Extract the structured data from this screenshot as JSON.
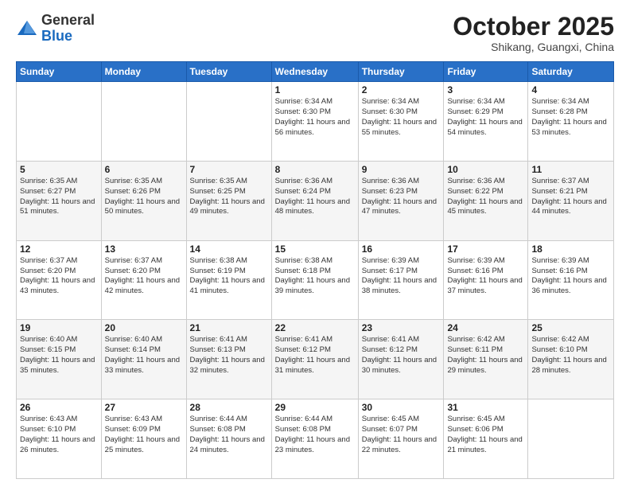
{
  "header": {
    "logo_general": "General",
    "logo_blue": "Blue",
    "month_title": "October 2025",
    "location": "Shikang, Guangxi, China"
  },
  "weekdays": [
    "Sunday",
    "Monday",
    "Tuesday",
    "Wednesday",
    "Thursday",
    "Friday",
    "Saturday"
  ],
  "weeks": [
    [
      {
        "day": "",
        "sunrise": "",
        "sunset": "",
        "daylight": ""
      },
      {
        "day": "",
        "sunrise": "",
        "sunset": "",
        "daylight": ""
      },
      {
        "day": "",
        "sunrise": "",
        "sunset": "",
        "daylight": ""
      },
      {
        "day": "1",
        "sunrise": "Sunrise: 6:34 AM",
        "sunset": "Sunset: 6:30 PM",
        "daylight": "Daylight: 11 hours and 56 minutes."
      },
      {
        "day": "2",
        "sunrise": "Sunrise: 6:34 AM",
        "sunset": "Sunset: 6:30 PM",
        "daylight": "Daylight: 11 hours and 55 minutes."
      },
      {
        "day": "3",
        "sunrise": "Sunrise: 6:34 AM",
        "sunset": "Sunset: 6:29 PM",
        "daylight": "Daylight: 11 hours and 54 minutes."
      },
      {
        "day": "4",
        "sunrise": "Sunrise: 6:34 AM",
        "sunset": "Sunset: 6:28 PM",
        "daylight": "Daylight: 11 hours and 53 minutes."
      }
    ],
    [
      {
        "day": "5",
        "sunrise": "Sunrise: 6:35 AM",
        "sunset": "Sunset: 6:27 PM",
        "daylight": "Daylight: 11 hours and 51 minutes."
      },
      {
        "day": "6",
        "sunrise": "Sunrise: 6:35 AM",
        "sunset": "Sunset: 6:26 PM",
        "daylight": "Daylight: 11 hours and 50 minutes."
      },
      {
        "day": "7",
        "sunrise": "Sunrise: 6:35 AM",
        "sunset": "Sunset: 6:25 PM",
        "daylight": "Daylight: 11 hours and 49 minutes."
      },
      {
        "day": "8",
        "sunrise": "Sunrise: 6:36 AM",
        "sunset": "Sunset: 6:24 PM",
        "daylight": "Daylight: 11 hours and 48 minutes."
      },
      {
        "day": "9",
        "sunrise": "Sunrise: 6:36 AM",
        "sunset": "Sunset: 6:23 PM",
        "daylight": "Daylight: 11 hours and 47 minutes."
      },
      {
        "day": "10",
        "sunrise": "Sunrise: 6:36 AM",
        "sunset": "Sunset: 6:22 PM",
        "daylight": "Daylight: 11 hours and 45 minutes."
      },
      {
        "day": "11",
        "sunrise": "Sunrise: 6:37 AM",
        "sunset": "Sunset: 6:21 PM",
        "daylight": "Daylight: 11 hours and 44 minutes."
      }
    ],
    [
      {
        "day": "12",
        "sunrise": "Sunrise: 6:37 AM",
        "sunset": "Sunset: 6:20 PM",
        "daylight": "Daylight: 11 hours and 43 minutes."
      },
      {
        "day": "13",
        "sunrise": "Sunrise: 6:37 AM",
        "sunset": "Sunset: 6:20 PM",
        "daylight": "Daylight: 11 hours and 42 minutes."
      },
      {
        "day": "14",
        "sunrise": "Sunrise: 6:38 AM",
        "sunset": "Sunset: 6:19 PM",
        "daylight": "Daylight: 11 hours and 41 minutes."
      },
      {
        "day": "15",
        "sunrise": "Sunrise: 6:38 AM",
        "sunset": "Sunset: 6:18 PM",
        "daylight": "Daylight: 11 hours and 39 minutes."
      },
      {
        "day": "16",
        "sunrise": "Sunrise: 6:39 AM",
        "sunset": "Sunset: 6:17 PM",
        "daylight": "Daylight: 11 hours and 38 minutes."
      },
      {
        "day": "17",
        "sunrise": "Sunrise: 6:39 AM",
        "sunset": "Sunset: 6:16 PM",
        "daylight": "Daylight: 11 hours and 37 minutes."
      },
      {
        "day": "18",
        "sunrise": "Sunrise: 6:39 AM",
        "sunset": "Sunset: 6:16 PM",
        "daylight": "Daylight: 11 hours and 36 minutes."
      }
    ],
    [
      {
        "day": "19",
        "sunrise": "Sunrise: 6:40 AM",
        "sunset": "Sunset: 6:15 PM",
        "daylight": "Daylight: 11 hours and 35 minutes."
      },
      {
        "day": "20",
        "sunrise": "Sunrise: 6:40 AM",
        "sunset": "Sunset: 6:14 PM",
        "daylight": "Daylight: 11 hours and 33 minutes."
      },
      {
        "day": "21",
        "sunrise": "Sunrise: 6:41 AM",
        "sunset": "Sunset: 6:13 PM",
        "daylight": "Daylight: 11 hours and 32 minutes."
      },
      {
        "day": "22",
        "sunrise": "Sunrise: 6:41 AM",
        "sunset": "Sunset: 6:12 PM",
        "daylight": "Daylight: 11 hours and 31 minutes."
      },
      {
        "day": "23",
        "sunrise": "Sunrise: 6:41 AM",
        "sunset": "Sunset: 6:12 PM",
        "daylight": "Daylight: 11 hours and 30 minutes."
      },
      {
        "day": "24",
        "sunrise": "Sunrise: 6:42 AM",
        "sunset": "Sunset: 6:11 PM",
        "daylight": "Daylight: 11 hours and 29 minutes."
      },
      {
        "day": "25",
        "sunrise": "Sunrise: 6:42 AM",
        "sunset": "Sunset: 6:10 PM",
        "daylight": "Daylight: 11 hours and 28 minutes."
      }
    ],
    [
      {
        "day": "26",
        "sunrise": "Sunrise: 6:43 AM",
        "sunset": "Sunset: 6:10 PM",
        "daylight": "Daylight: 11 hours and 26 minutes."
      },
      {
        "day": "27",
        "sunrise": "Sunrise: 6:43 AM",
        "sunset": "Sunset: 6:09 PM",
        "daylight": "Daylight: 11 hours and 25 minutes."
      },
      {
        "day": "28",
        "sunrise": "Sunrise: 6:44 AM",
        "sunset": "Sunset: 6:08 PM",
        "daylight": "Daylight: 11 hours and 24 minutes."
      },
      {
        "day": "29",
        "sunrise": "Sunrise: 6:44 AM",
        "sunset": "Sunset: 6:08 PM",
        "daylight": "Daylight: 11 hours and 23 minutes."
      },
      {
        "day": "30",
        "sunrise": "Sunrise: 6:45 AM",
        "sunset": "Sunset: 6:07 PM",
        "daylight": "Daylight: 11 hours and 22 minutes."
      },
      {
        "day": "31",
        "sunrise": "Sunrise: 6:45 AM",
        "sunset": "Sunset: 6:06 PM",
        "daylight": "Daylight: 11 hours and 21 minutes."
      },
      {
        "day": "",
        "sunrise": "",
        "sunset": "",
        "daylight": ""
      }
    ]
  ]
}
